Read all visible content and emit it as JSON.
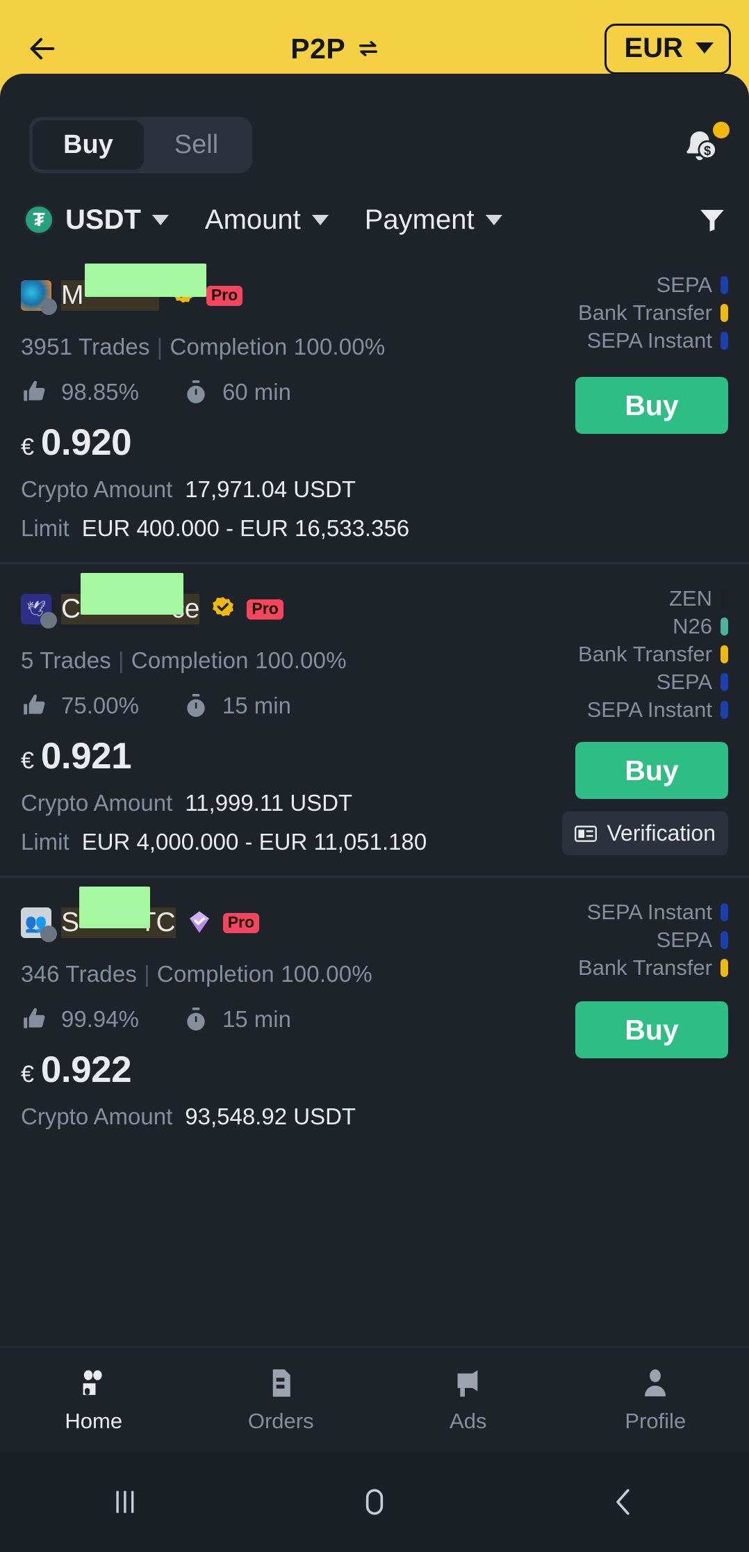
{
  "header": {
    "back_icon": "arrow-left-icon",
    "title": "P2P",
    "swap_icon": "swap-horizontal-icon",
    "currency": "EUR",
    "currency_caret": "chevron-down-icon",
    "bg_color": "#f5d042"
  },
  "toggle": {
    "buy_label": "Buy",
    "sell_label": "Sell",
    "active": "Buy"
  },
  "alert": {
    "icon": "bell-dollar-icon",
    "badge_color": "#f0b90b"
  },
  "filters": {
    "asset": "USDT",
    "asset_icon": "tether-icon",
    "amount": "Amount",
    "payment": "Payment",
    "filter_icon": "funnel-icon"
  },
  "labels": {
    "trades_suffix": "Trades",
    "completion_prefix": "Completion",
    "crypto_amount": "Crypto Amount",
    "limit": "Limit",
    "buy_button": "Buy",
    "verification": "Verification",
    "currency_symbol": "€",
    "thumbs_icon": "thumbs-up-icon",
    "timer_icon": "stopwatch-icon",
    "verification_icon": "id-card-icon",
    "verified_icon": "verified-badge-icon",
    "pro_badge": "Pro"
  },
  "listings": [
    {
      "name_visible_prefix": "M",
      "name_visible_suffix": "",
      "name_redacted": true,
      "verified_type": "gold",
      "pro": "Pro",
      "trades": "3951 Trades",
      "completion": "Completion 100.00%",
      "rating": "98.85%",
      "time": "60 min",
      "price": "0.920",
      "crypto_amount": "17,971.04 USDT",
      "limit": "EUR 400.000 - EUR 16,533.356",
      "payments": [
        {
          "label": "SEPA",
          "color": "#1c3fb0"
        },
        {
          "label": "Bank Transfer",
          "color": "#f0b90b"
        },
        {
          "label": "SEPA Instant",
          "color": "#1c3fb0"
        }
      ],
      "has_verification_chip": false
    },
    {
      "name_visible_prefix": "C",
      "name_visible_suffix": "ce",
      "name_redacted": true,
      "verified_type": "gold",
      "pro": "Pro",
      "trades": "5 Trades",
      "completion": "Completion 100.00%",
      "rating": "75.00%",
      "time": "15 min",
      "price": "0.921",
      "crypto_amount": "11,999.11 USDT",
      "limit": "EUR 4,000.000 - EUR 11,051.180",
      "payments": [
        {
          "label": "ZEN",
          "color": "#1d2127"
        },
        {
          "label": "N26",
          "color": "#48b39a"
        },
        {
          "label": "Bank Transfer",
          "color": "#f0b90b"
        },
        {
          "label": "SEPA",
          "color": "#1c3fb0"
        },
        {
          "label": "SEPA Instant",
          "color": "#1c3fb0"
        }
      ],
      "has_verification_chip": true
    },
    {
      "name_visible_prefix": "S",
      "name_visible_suffix": "TC",
      "name_redacted": true,
      "verified_type": "purple",
      "pro": "Pro",
      "trades": "346 Trades",
      "completion": "Completion 100.00%",
      "rating": "99.94%",
      "time": "15 min",
      "price": "0.922",
      "crypto_amount": "93,548.92 USDT",
      "limit": "",
      "payments": [
        {
          "label": "SEPA Instant",
          "color": "#1c3fb0"
        },
        {
          "label": "SEPA",
          "color": "#1c3fb0"
        },
        {
          "label": "Bank Transfer",
          "color": "#f0b90b"
        }
      ],
      "has_verification_chip": false
    }
  ],
  "bottom_nav": {
    "items": [
      {
        "label": "Home",
        "icon": "people-icon",
        "active": true
      },
      {
        "label": "Orders",
        "icon": "document-icon",
        "active": false
      },
      {
        "label": "Ads",
        "icon": "megaphone-icon",
        "active": false
      },
      {
        "label": "Profile",
        "icon": "person-icon",
        "active": false
      }
    ]
  },
  "system_bar": {
    "recents_icon": "recents-icon",
    "home_icon": "home-circle-icon",
    "back_icon": "back-chevron-icon"
  }
}
